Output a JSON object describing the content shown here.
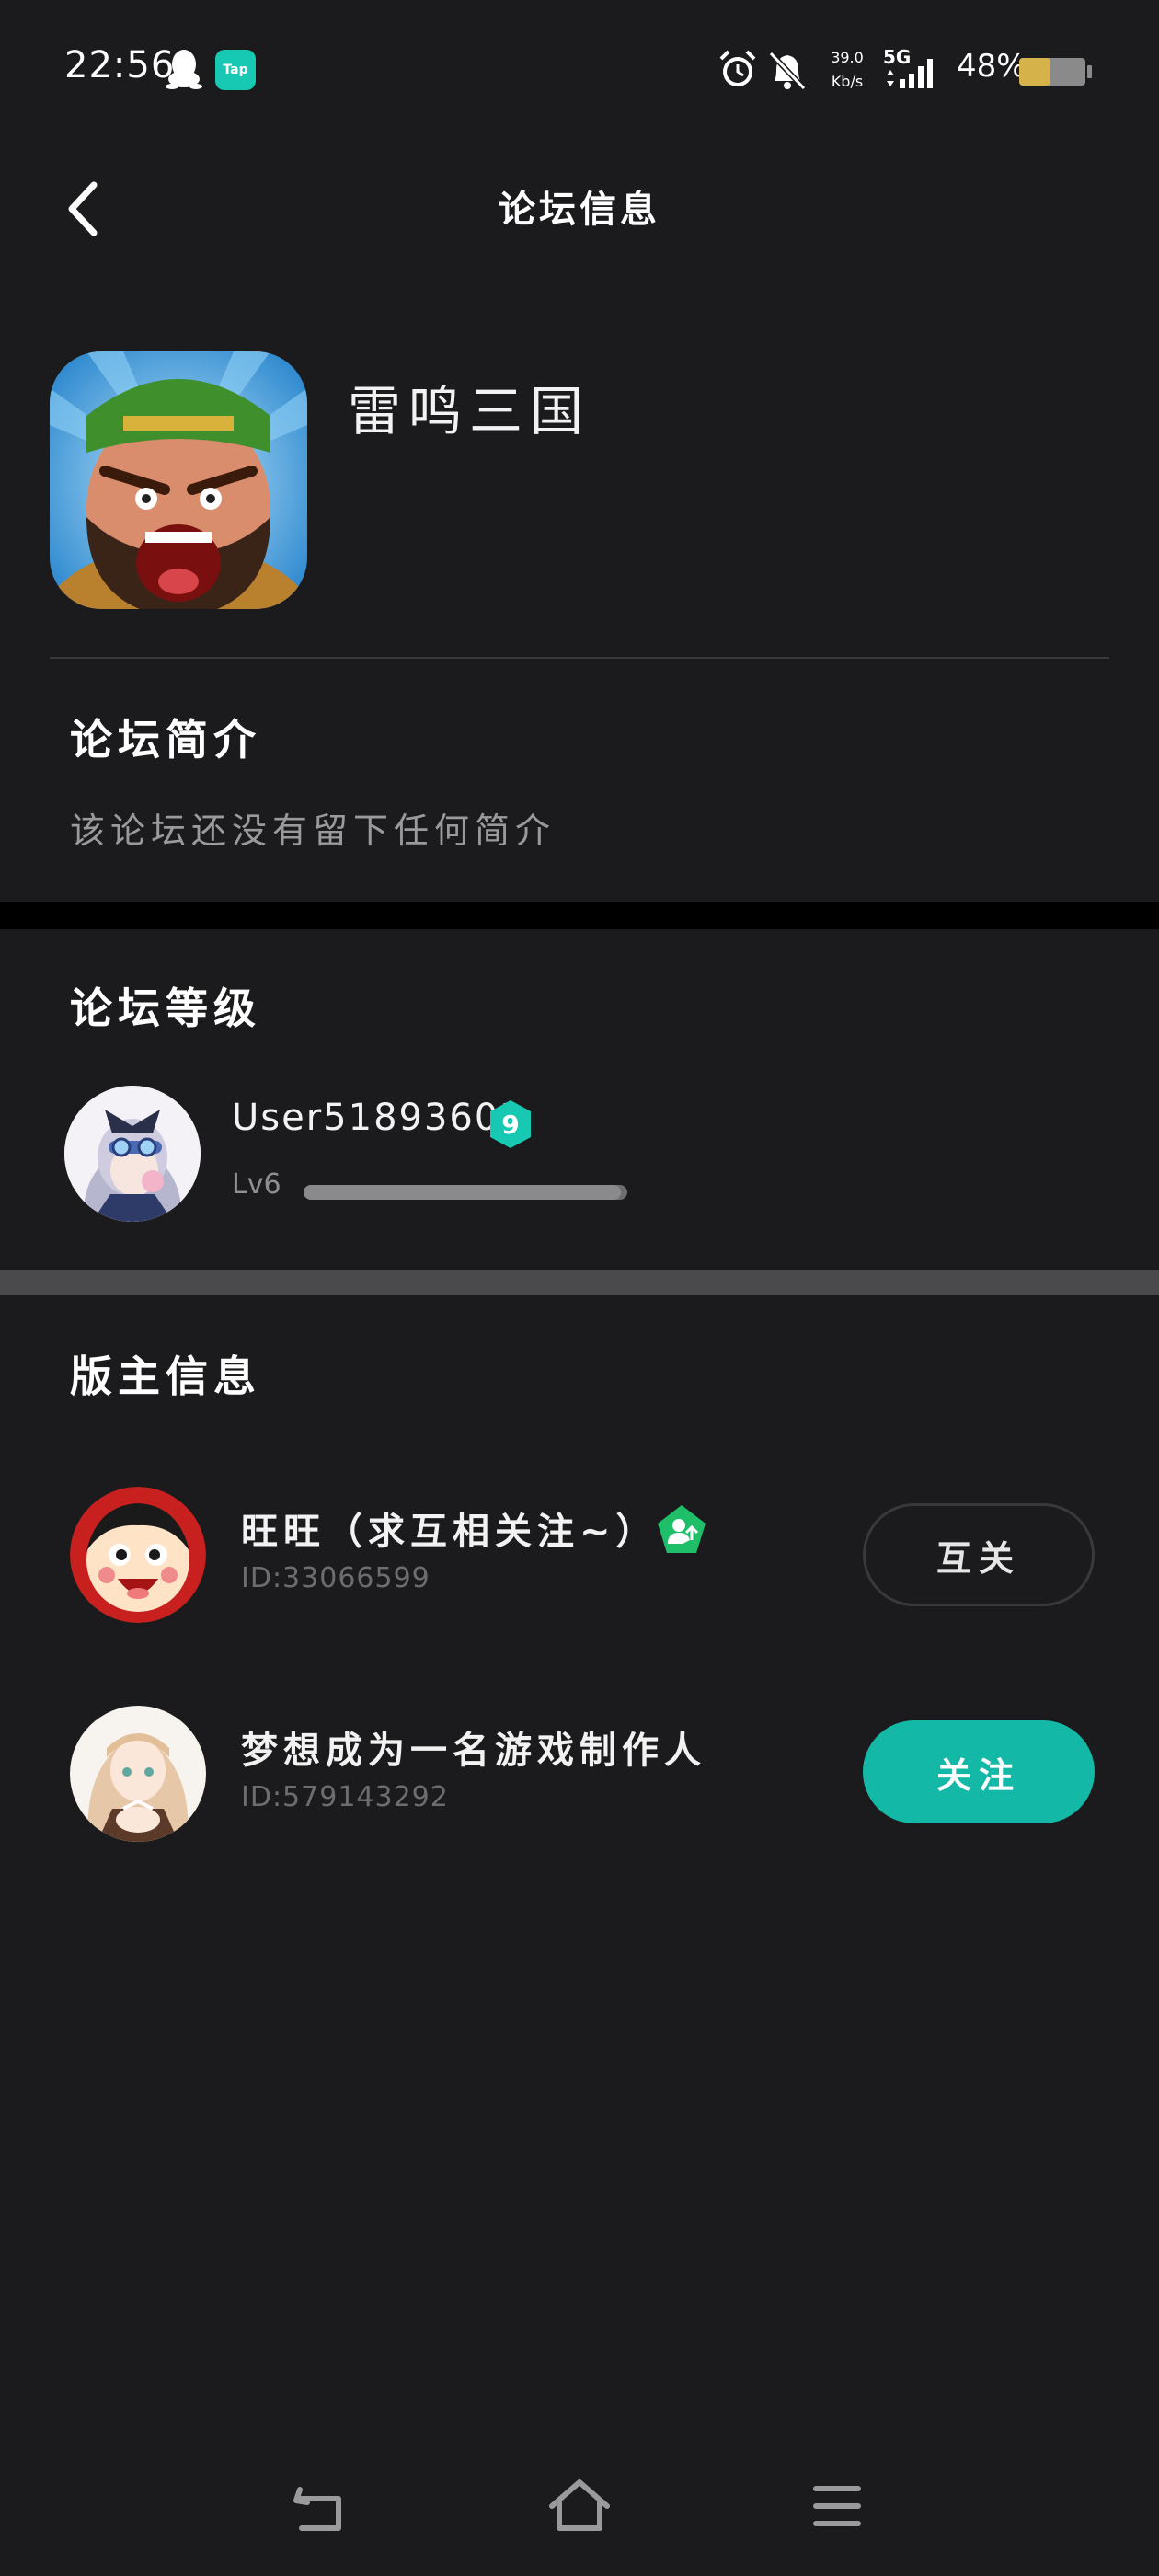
{
  "status_bar": {
    "time": "22:56",
    "tap_label": "Tap",
    "net_speed_value": "39.0",
    "net_speed_unit": "Kb/s",
    "network": "5G",
    "battery": "48%"
  },
  "header": {
    "title": "论坛信息"
  },
  "forum": {
    "game_name": "雷鸣三国"
  },
  "intro": {
    "title": "论坛简介",
    "text": "该论坛还没有留下任何简介"
  },
  "level": {
    "title": "论坛等级",
    "user_name": "User51893603",
    "badge_number": "9",
    "level_label": "Lv6",
    "progress": 0.98
  },
  "moderators": {
    "title": "版主信息",
    "items": [
      {
        "name": "旺旺（求互相关注~）",
        "id": "ID:33066599",
        "action": "互关"
      },
      {
        "name": "梦想成为一名游戏制作人",
        "id": "ID:579143292",
        "action": "关注"
      }
    ]
  },
  "colors": {
    "background": "#1b1b1d",
    "accent": "#14b8a6",
    "badge_teal": "#17c9b3",
    "badge_green": "#1fbf6a"
  },
  "icons": {
    "back": "chevron-left-icon",
    "qq": "qq-penguin-icon",
    "alarm": "alarm-clock-icon",
    "mute": "bell-off-icon",
    "nav_back": "return-icon",
    "nav_home": "home-icon",
    "nav_menu": "menu-icon"
  }
}
